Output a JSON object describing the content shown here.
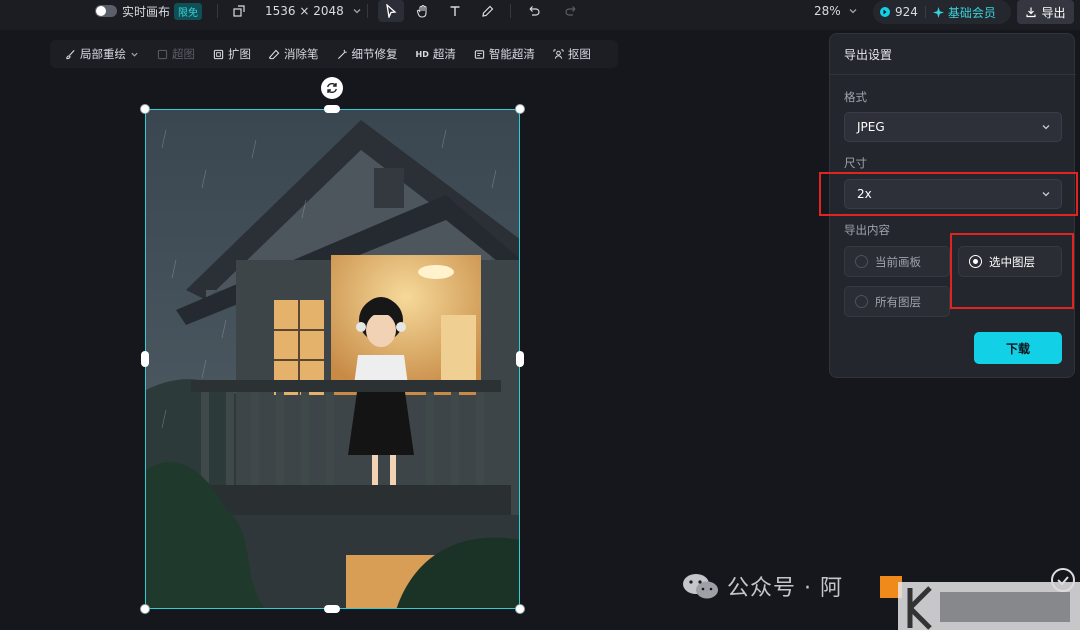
{
  "topbar": {
    "realtime_label": "实时画布",
    "realtime_badge": "限免",
    "canvas_size": "1536 × 2048",
    "zoom": "28%",
    "credits": "924",
    "membership": "基础会员",
    "export_label": "导出"
  },
  "subtoolbar": {
    "items": [
      {
        "label": "局部重绘",
        "icon": "brush-icon",
        "enabled": true
      },
      {
        "label": "超图",
        "icon": "layers-icon",
        "enabled": false
      },
      {
        "label": "扩图",
        "icon": "expand-icon",
        "enabled": true
      },
      {
        "label": "消除笔",
        "icon": "eraser-icon",
        "enabled": true
      },
      {
        "label": "细节修复",
        "icon": "magic-wand-icon",
        "enabled": true
      },
      {
        "label": "超清",
        "icon": "hd-icon",
        "enabled": true
      },
      {
        "label": "智能超清",
        "icon": "smart-hd-icon",
        "enabled": true
      },
      {
        "label": "抠图",
        "icon": "cutout-icon",
        "enabled": true
      }
    ],
    "hd_prefix": "HD"
  },
  "export_panel": {
    "title": "导出设置",
    "format_label": "格式",
    "format_value": "JPEG",
    "size_label": "尺寸",
    "size_value": "2x",
    "content_label": "导出内容",
    "options": [
      {
        "label": "当前画板",
        "selected": false
      },
      {
        "label": "选中图层",
        "selected": true
      },
      {
        "label": "所有图层",
        "selected": false
      }
    ],
    "download_label": "下载"
  },
  "watermark": {
    "text": "公众号 · 阿"
  },
  "colors": {
    "accent": "#12d1e6",
    "selection": "#2ad0d6",
    "highlight": "#e0241f",
    "background": "#15171c"
  }
}
